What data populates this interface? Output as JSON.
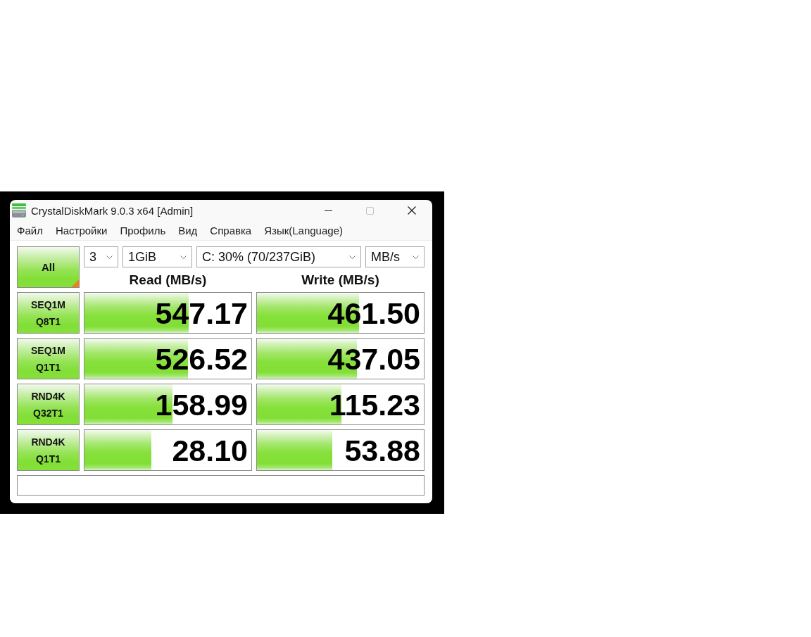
{
  "window": {
    "title": "CrystalDiskMark 9.0.3 x64 [Admin]",
    "controls": [
      {
        "kind": "minimize",
        "disabled": false
      },
      {
        "kind": "maximize",
        "disabled": true
      },
      {
        "kind": "close",
        "disabled": false
      }
    ]
  },
  "menu": [
    "Файл",
    "Настройки",
    "Профиль",
    "Вид",
    "Справка",
    "Язык(Language)"
  ],
  "toolbar": {
    "all_button": "All",
    "dropdowns": [
      {
        "value": "3"
      },
      {
        "value": "1GiB"
      },
      {
        "value": "C: 30% (70/237GiB)"
      },
      {
        "value": "MB/s"
      }
    ]
  },
  "headers": [
    "Read (MB/s)",
    "Write (MB/s)"
  ],
  "tests": [
    {
      "name": "SEQ1M",
      "params": "Q8T1",
      "read": {
        "value": "547.17",
        "level": 0.623
      },
      "write": {
        "value": "461.50",
        "level": 0.611
      }
    },
    {
      "name": "SEQ1M",
      "params": "Q1T1",
      "read": {
        "value": "526.52",
        "level": 0.619
      },
      "write": {
        "value": "437.05",
        "level": 0.6
      }
    },
    {
      "name": "RND4K",
      "params": "Q32T1",
      "read": {
        "value": "158.99",
        "level": 0.527
      },
      "write": {
        "value": "115.23",
        "level": 0.506
      }
    },
    {
      "name": "RND4K",
      "params": "Q1T1",
      "read": {
        "value": "28.10",
        "level": 0.4
      },
      "write": {
        "value": "53.88",
        "level": 0.45
      }
    }
  ]
}
